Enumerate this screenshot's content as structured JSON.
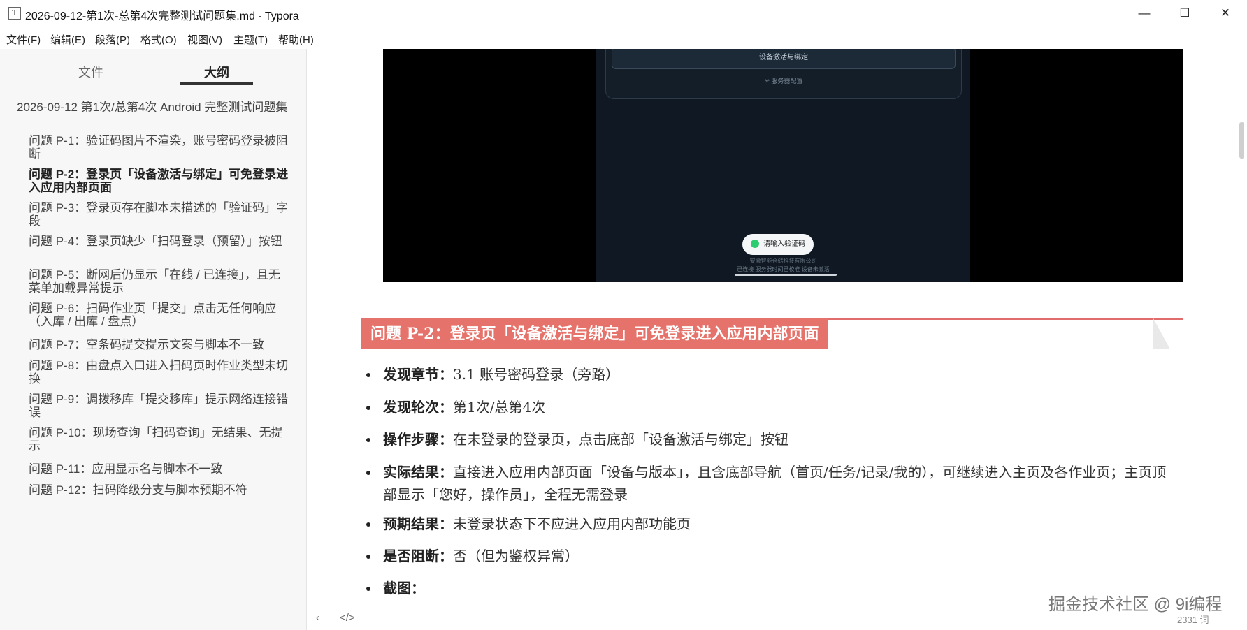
{
  "window": {
    "icon_glyph": "T",
    "title": "2026-09-12-第1次-总第4次完整测试问题集.md - Typora",
    "minimize": "—",
    "maximize": "☐",
    "close": "✕"
  },
  "menu": [
    "文件(F)",
    "编辑(E)",
    "段落(P)",
    "格式(O)",
    "视图(V)",
    "主题(T)",
    "帮助(H)"
  ],
  "sidebar": {
    "tab_files": "文件",
    "tab_outline": "大纲",
    "outline": [
      {
        "text": "2026-09-12 第1次/总第4次 Android 完整测试问题集",
        "level": 1
      },
      {
        "text": "问题 P-1：验证码图片不渲染，账号密码登录被阻断",
        "level": 2
      },
      {
        "text": "问题 P-2：登录页「设备激活与绑定」可免登录进入应用内部页面",
        "level": 2,
        "active": true
      },
      {
        "text": "问题 P-3：登录页存在脚本未描述的「验证码」字段",
        "level": 2
      },
      {
        "text": "问题 P-4：登录页缺少「扫码登录（预留）」按钮",
        "level": 2
      },
      {
        "text": "问题 P-5：断网后仍显示「在线 / 已连接」，且无菜单加载异常提示",
        "level": 2
      },
      {
        "text": "问题 P-6：扫码作业页「提交」点击无任何响应（入库 / 出库 / 盘点）",
        "level": 2
      },
      {
        "text": "问题 P-7：空条码提交提示文案与脚本不一致",
        "level": 2
      },
      {
        "text": "问题 P-8：由盘点入口进入扫码页时作业类型未切换",
        "level": 2
      },
      {
        "text": "问题 P-9：调拨移库「提交移库」提示网络连接错误",
        "level": 2
      },
      {
        "text": "问题 P-10：现场查询「扫码查询」无结果、无提示",
        "level": 2
      },
      {
        "text": "问题 P-11：应用显示名与脚本不一致",
        "level": 2
      },
      {
        "text": "问题 P-12：扫码降级分支与脚本预期不符",
        "level": 2
      }
    ]
  },
  "screenshot": {
    "activate_button": "设备激活与绑定",
    "config_link": "✳ 服务器配置",
    "code_pill": "请输入验证码",
    "footer_company": "安徽智能仓储科技有限公司",
    "footer_status": "已连接  服务器时间已校准  设备未激活"
  },
  "content": {
    "heading": "问题 P-2：登录页「设备激活与绑定」可免登录进入应用内部页面",
    "items": [
      {
        "label": "发现章节：",
        "text": "3.1 账号密码登录（旁路）"
      },
      {
        "label": "发现轮次：",
        "text": "第1次/总第4次"
      },
      {
        "label": "操作步骤：",
        "text": "在未登录的登录页，点击底部「设备激活与绑定」按钮"
      },
      {
        "label": "实际结果：",
        "text": "直接进入应用内部页面「设备与版本」，且含底部导航（首页/任务/记录/我的），可继续进入主页及各作业页；主页顶部显示「您好，操作员」，全程无需登录"
      },
      {
        "label": "预期结果：",
        "text": "未登录状态下不应进入应用内部功能页"
      },
      {
        "label": "是否阻断：",
        "text": "否（但为鉴权异常）"
      },
      {
        "label": "截图：",
        "text": ""
      }
    ]
  },
  "statusbar": {
    "back": "‹",
    "source_toggle": "</>",
    "watermark": "掘金技术社区 @ 9i编程",
    "word_count": "2331 词"
  },
  "colors": {
    "heading_bg": "#e6736b",
    "heading_rule": "#e06c6c",
    "sidebar_bg": "#f7f7f7"
  }
}
